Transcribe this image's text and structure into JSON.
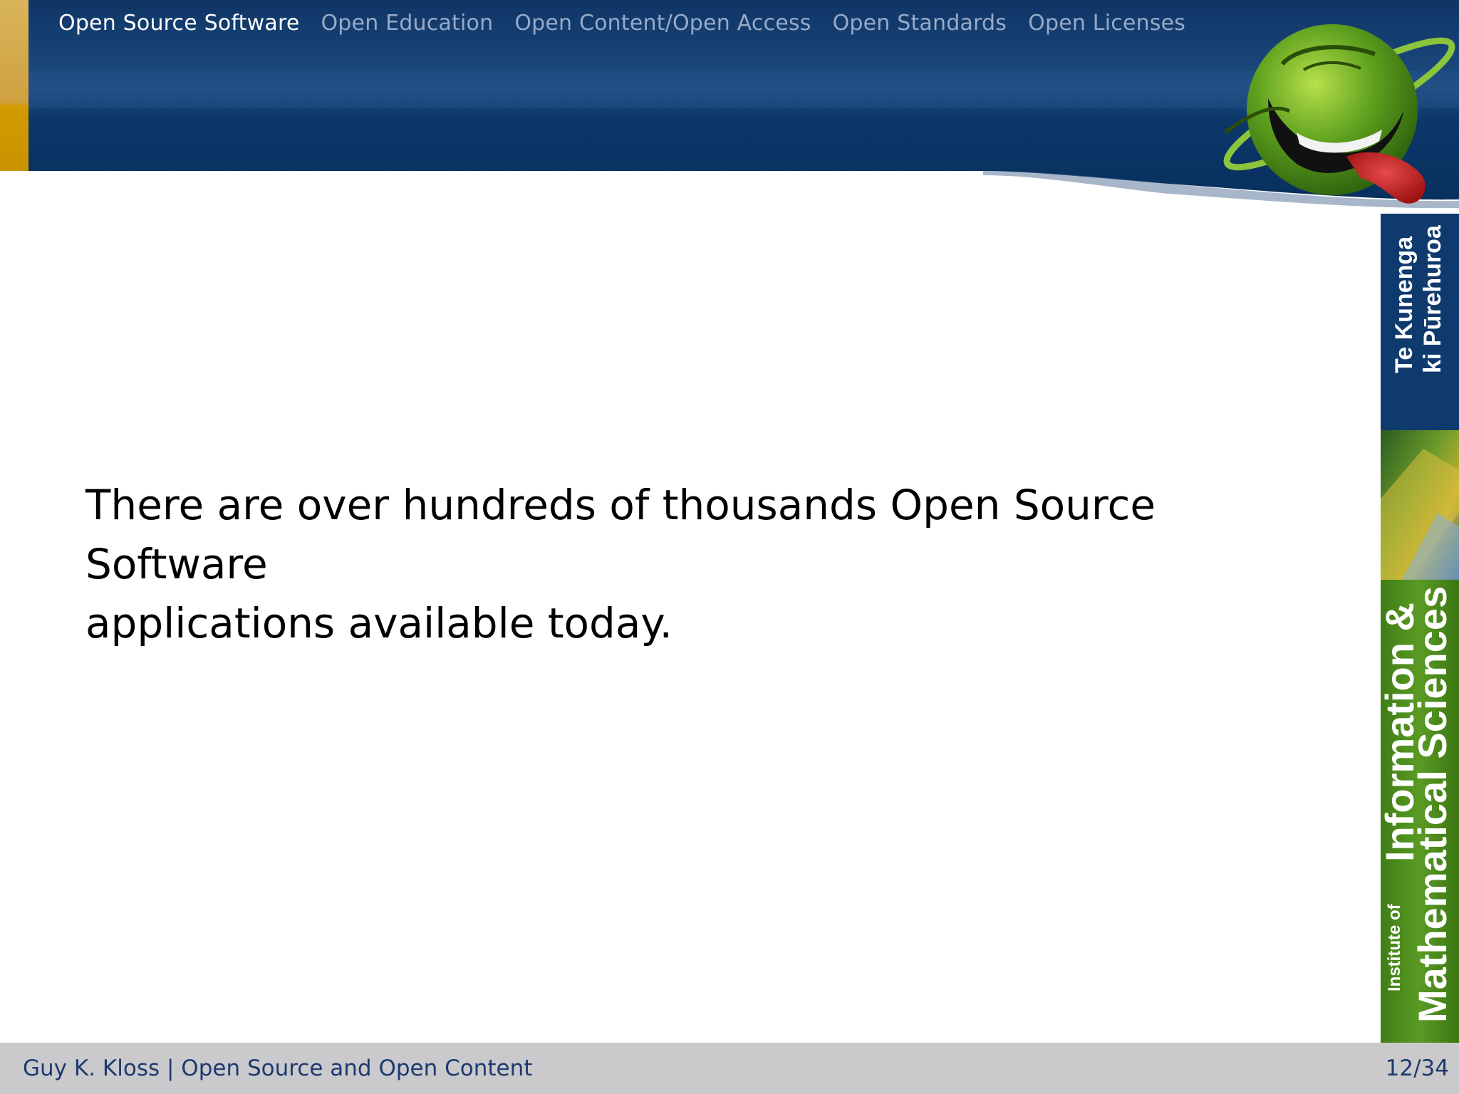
{
  "nav": {
    "items": [
      {
        "label": "Open Source Software",
        "active": true
      },
      {
        "label": "Open Education",
        "active": false
      },
      {
        "label": "Open Content/Open Access",
        "active": false
      },
      {
        "label": "Open Standards",
        "active": false
      },
      {
        "label": "Open Licenses",
        "active": false
      }
    ]
  },
  "banner": {
    "maori_line1": "Te Kunenga",
    "maori_line2": "ki Pūrehuroa",
    "institute_prefix": "Institute of",
    "institute_line1": "Information &",
    "institute_line2": "Mathematical Sciences"
  },
  "mascot": {
    "icon": "green-alien-tongue-icon"
  },
  "content": {
    "line1": "There are over hundreds of thousands Open Source Software",
    "line2": "applications available today."
  },
  "footer": {
    "author": "Guy K. Kloss",
    "separator": "|",
    "title": "Open Source and Open Content",
    "page": "12/34"
  },
  "colors": {
    "header_blue": "#0f3a6e",
    "gold_accent": "#d6a000",
    "nav_active": "#ffffff",
    "nav_inactive": "#97aac8",
    "footer_bg": "#cacacd",
    "footer_text": "#1d3a6e",
    "banner_green": "#4a8a1c"
  }
}
